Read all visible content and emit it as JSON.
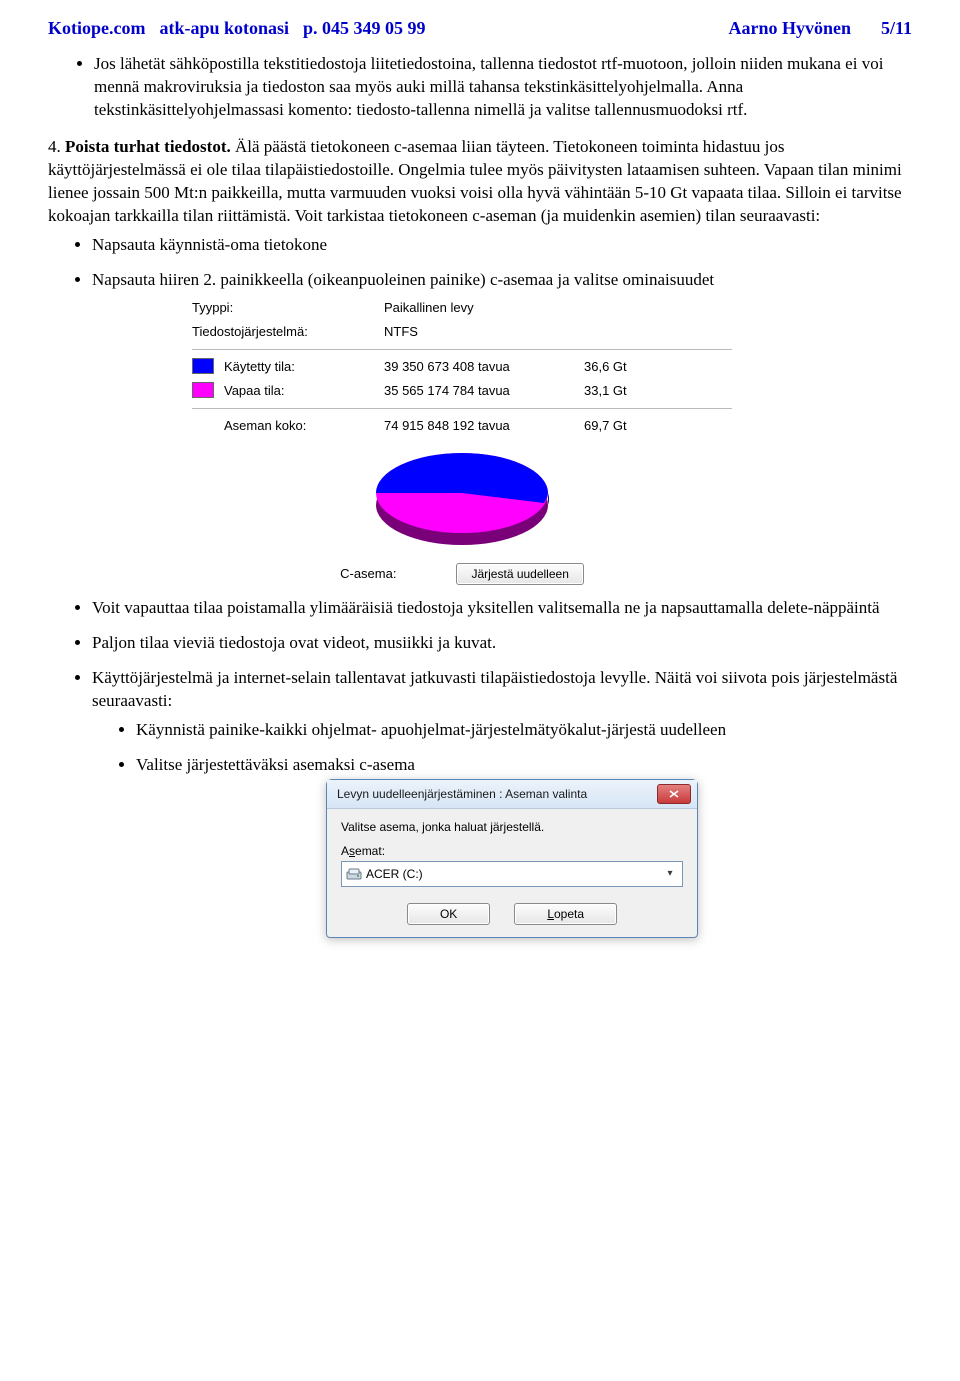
{
  "header": {
    "site": "Kotiope.com",
    "tagline": "atk-apu kotonasi",
    "phone": "p. 045 349 05 99",
    "author": "Aarno Hyvönen",
    "page": "5/11"
  },
  "bullet_top": "Jos lähetät sähköpostilla tekstitiedostoja liitetiedostoina, tallenna tiedostot rtf-muotoon, jolloin niiden mukana ei voi mennä makroviruksia ja tiedoston saa myös auki millä tahansa tekstinkäsittelyohjelmalla. Anna tekstinkäsittelyohjelmassasi komento: tiedosto-tallenna nimellä ja valitse tallennusmuodoksi rtf.",
  "item4": {
    "num": "4.",
    "bold": "Poista turhat tiedostot.",
    "rest": "Älä päästä tietokoneen c-asemaa liian täyteen. Tietokoneen toiminta hidastuu jos käyttöjärjestelmässä ei ole tilaa tilapäistiedostoille. Ongelmia tulee myös päivitysten lataamisen suhteen. Vapaan tilan minimi lienee jossain 500 Mt:n paikkeilla, mutta varmuuden vuoksi voisi olla hyvä vähintään 5-10 Gt vapaata tilaa. Silloin ei tarvitse kokoajan tarkkailla tilan riittämistä. Voit tarkistaa tietokoneen c-aseman (ja muidenkin asemien) tilan seuraavasti:"
  },
  "sub1": "Napsauta käynnistä-oma tietokone",
  "sub2": "Napsauta hiiren 2. painikkeella (oikeanpuoleinen painike) c-asemaa ja valitse ominaisuudet",
  "props": {
    "type_label": "Tyyppi:",
    "type_value": "Paikallinen levy",
    "fs_label": "Tiedostojärjestelmä:",
    "fs_value": "NTFS",
    "used_label": "Käytetty tila:",
    "used_bytes": "39 350 673 408 tavua",
    "used_gb": "36,6 Gt",
    "free_label": "Vapaa tila:",
    "free_bytes": "35 565 174 784 tavua",
    "free_gb": "33,1 Gt",
    "size_label": "Aseman koko:",
    "size_bytes": "74 915 848 192 tavua",
    "size_gb": "69,7 Gt",
    "drive_label": "C-asema:",
    "reorg_btn": "Järjestä uudelleen"
  },
  "bullet_a": "Voit vapauttaa tilaa poistamalla ylimääräisiä tiedostoja yksitellen valitsemalla ne ja napsauttamalla delete-näppäintä",
  "bullet_b": "Paljon tilaa vieviä tiedostoja ovat videot, musiikki ja kuvat.",
  "bullet_c": "Käyttöjärjestelmä ja internet-selain tallentavat jatkuvasti tilapäistiedostoja levylle. Näitä voi siivota pois järjestelmästä seuraavasti:",
  "bullet_c_s1": "Käynnistä painike-kaikki ohjelmat- apuohjelmat-järjestelmätyökalut-järjestä uudelleen",
  "bullet_c_s2": "Valitse järjestettäväksi asemaksi c-asema",
  "dialog": {
    "title": "Levyn uudelleenjärjestäminen : Aseman valinta",
    "instruction": "Valitse asema, jonka haluat järjestellä.",
    "field_label_pre": "A",
    "field_label_u": "s",
    "field_label_post": "emat:",
    "selected": "ACER (C:)",
    "ok": "OK",
    "cancel_pre": "",
    "cancel_u": "L",
    "cancel_post": "opeta"
  },
  "chart_data": {
    "type": "pie",
    "title": "C-asema:",
    "series": [
      {
        "name": "Käytetty tila",
        "value": 36.6,
        "unit": "Gt",
        "color": "#0000ff"
      },
      {
        "name": "Vapaa tila",
        "value": 33.1,
        "unit": "Gt",
        "color": "#ff00ff"
      }
    ],
    "total": {
      "label": "Aseman koko",
      "value": 69.7,
      "unit": "Gt"
    }
  }
}
